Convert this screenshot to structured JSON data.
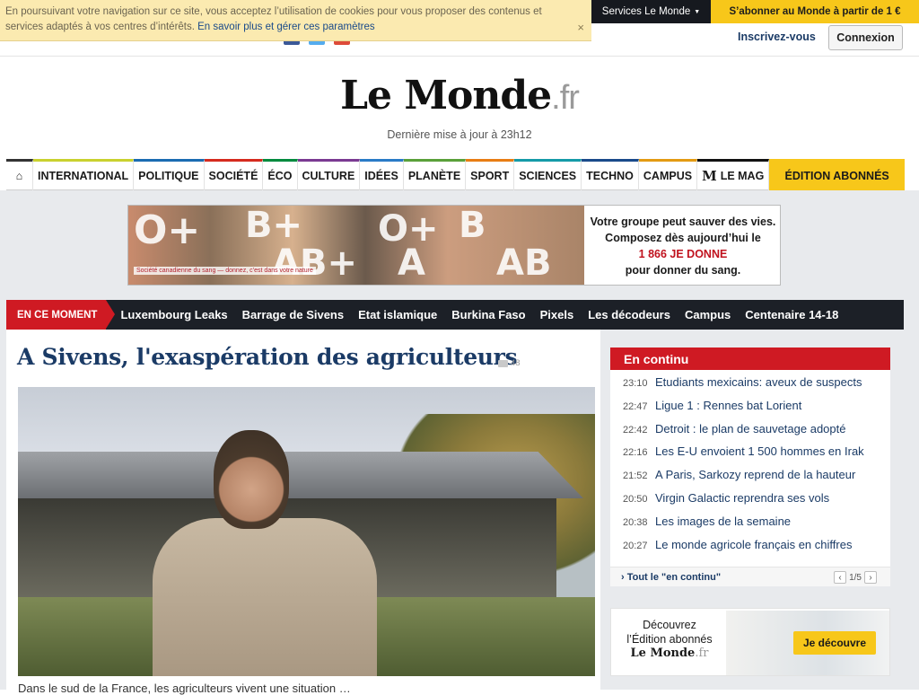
{
  "cookie_banner": {
    "text": "En poursuivant votre navigation sur ce site, vous acceptez l’utilisation de cookies pour vous proposer des contenus et services adaptés à vos centres d’intérêts.",
    "link": "En savoir plus et gérer ces paramètres",
    "close": "×"
  },
  "top_bar": {
    "services_label": "Services Le Monde",
    "subscribe_label": "S’abonner au Monde à partir de 1 €",
    "signup_label": "Inscrivez-vous",
    "login_label": "Connexion"
  },
  "masthead": {
    "logo": "Le Monde",
    "logo_suffix": ".fr",
    "updated": "Dernière mise à jour à 23h12"
  },
  "nav": {
    "home_icon": "⌂",
    "items": [
      {
        "label": "INTERNATIONAL",
        "color": "#c9d12f"
      },
      {
        "label": "POLITIQUE",
        "color": "#1b6cb2"
      },
      {
        "label": "SOCIÉTÉ",
        "color": "#d52b1e"
      },
      {
        "label": "ÉCO",
        "color": "#008a3e"
      },
      {
        "label": "CULTURE",
        "color": "#7a3a92"
      },
      {
        "label": "IDÉES",
        "color": "#2a7bc7"
      },
      {
        "label": "PLANÈTE",
        "color": "#5aa03a"
      },
      {
        "label": "SPORT",
        "color": "#e87d14"
      },
      {
        "label": "SCIENCES",
        "color": "#159ba8"
      },
      {
        "label": "TECHNO",
        "color": "#1a4a8a"
      },
      {
        "label": "CAMPUS",
        "color": "#e39b13"
      }
    ],
    "mag_label": "LE MAG",
    "mag_icon": "M",
    "abonnes_label": "ÉDITION ABONNÉS"
  },
  "ad": {
    "org": "Société canadienne du sang — donnez, c’est dans votre nature",
    "line1": "Votre groupe peut sauver des vies.",
    "line2": "Composez dès aujourd’hui le",
    "phone": "1 866 JE DONNE",
    "line3": "pour donner du sang.",
    "blood_types": [
      "O+",
      "B+",
      "AB+",
      "O+",
      "A",
      "B",
      "AB"
    ]
  },
  "en_ce_moment": {
    "tag": "EN CE MOMENT",
    "topics": [
      "Luxembourg Leaks",
      "Barrage de Sivens",
      "Etat islamique",
      "Burkina Faso",
      "Pixels",
      "Les décodeurs",
      "Campus",
      "Centenaire 14-18"
    ]
  },
  "article": {
    "headline": "A Sivens, l'exaspération des agriculteurs",
    "comments": "48",
    "caption": "Dans le sud de la France, les agriculteurs vivent une situation …"
  },
  "en_continu": {
    "title": "En continu",
    "items": [
      {
        "time": "23:10",
        "title": "Etudiants mexicains: aveux de suspects"
      },
      {
        "time": "22:47",
        "title": "Ligue 1 : Rennes bat Lorient"
      },
      {
        "time": "22:42",
        "title": "Detroit : le plan de sauvetage adopté"
      },
      {
        "time": "22:16",
        "title": "Les E-U envoient 1 500 hommes en Irak"
      },
      {
        "time": "21:52",
        "title": "A Paris, Sarkozy reprend de la hauteur"
      },
      {
        "time": "20:50",
        "title": "Virgin Galactic reprendra ses vols"
      },
      {
        "time": "20:38",
        "title": "Les images de la semaine"
      },
      {
        "time": "20:27",
        "title": "Le monde agricole français en chiffres"
      }
    ],
    "all_label": "› Tout le \"en continu\"",
    "pager": "1/5",
    "prev": "‹",
    "next": "›"
  },
  "promo": {
    "line1": "Découvrez",
    "line2": "l’Édition abonnés",
    "logo": "Le Monde",
    "logo_suffix": ".fr",
    "cta": "Je découvre"
  },
  "colors": {
    "brand_blue": "#1b3b66",
    "alert_red": "#cf1a23",
    "abonnes_yellow": "#f7c71a",
    "dark_bar": "#1c2027"
  }
}
